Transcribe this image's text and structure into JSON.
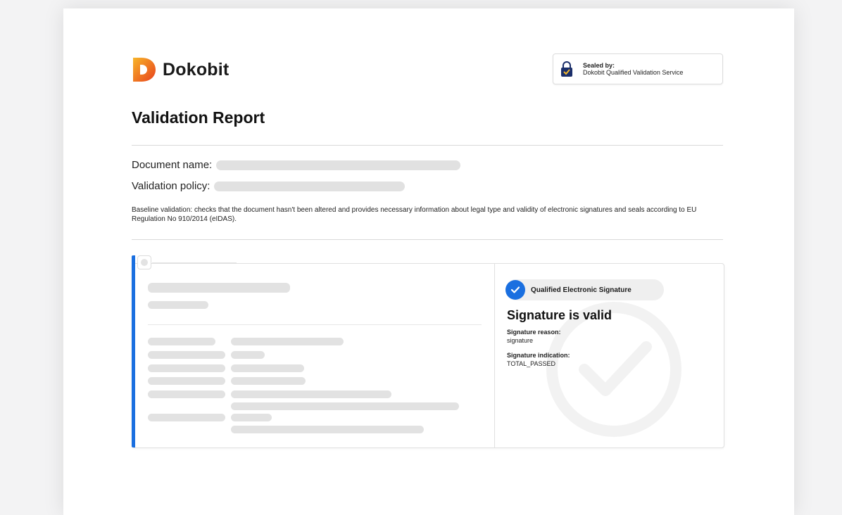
{
  "brand": {
    "name": "Dokobit"
  },
  "seal": {
    "label": "Sealed by:",
    "service": "Dokobit Qualified Validation Service"
  },
  "report": {
    "title": "Validation Report",
    "document_name_label": "Document name:",
    "validation_policy_label": "Validation policy:",
    "description": "Baseline validation: checks that the document hasn't been altered and provides necessary information about legal type and validity of electronic signatures and seals according to EU Regulation No 910/2014 (eIDAS)."
  },
  "signature": {
    "badge": "Qualified Electronic Signature",
    "status": "Signature is valid",
    "reason_label": "Signature reason:",
    "reason_value": "signature",
    "indication_label": "Signature indication:",
    "indication_value": "TOTAL_PASSED"
  },
  "colors": {
    "accent": "#1a6fe0",
    "logo_orange": "#f39a1e",
    "logo_red": "#e8401c"
  },
  "icons": {
    "seal": "lock-icon",
    "badge": "check-icon"
  }
}
